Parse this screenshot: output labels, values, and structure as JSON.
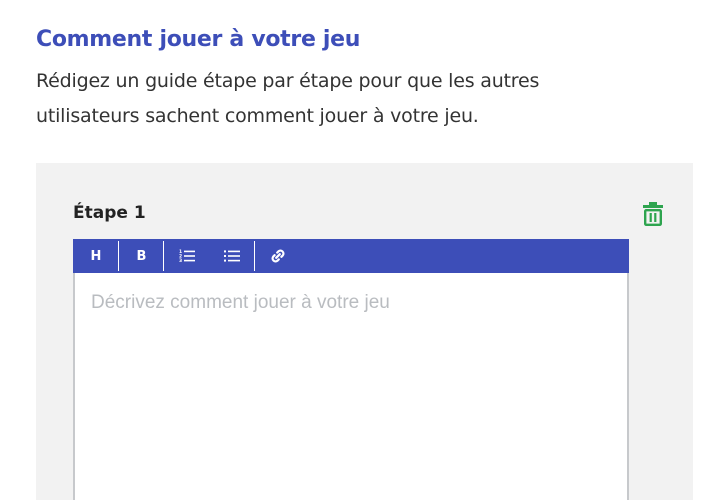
{
  "section": {
    "title": "Comment jouer à votre jeu",
    "description": "Rédigez un guide étape par étape pour que les autres utilisateurs sachent comment jouer à votre jeu."
  },
  "step": {
    "label": "Étape 1",
    "delete_icon": "trash-icon",
    "delete_color": "#2ea44f"
  },
  "toolbar": {
    "background": "#3d4eb8",
    "buttons": [
      {
        "name": "heading",
        "label": "H",
        "icon": "heading-icon"
      },
      {
        "name": "bold",
        "label": "B",
        "icon": "bold-icon"
      },
      {
        "name": "ordered-list",
        "label": "",
        "icon": "ordered-list-icon"
      },
      {
        "name": "bullet-list",
        "label": "",
        "icon": "bullet-list-icon"
      },
      {
        "name": "link",
        "label": "",
        "icon": "link-icon"
      }
    ]
  },
  "editor": {
    "placeholder": "Décrivez comment jouer à votre jeu",
    "value": ""
  }
}
